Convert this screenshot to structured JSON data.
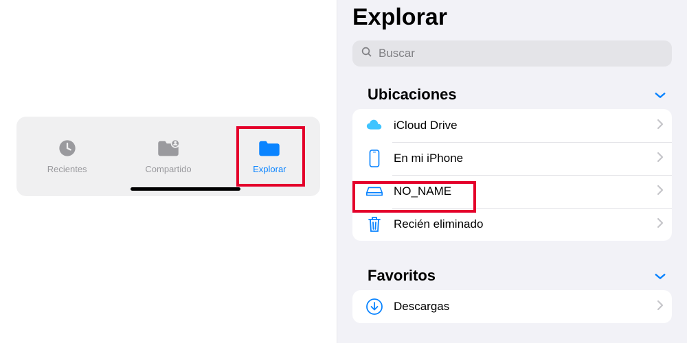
{
  "tabs": {
    "recent": "Recientes",
    "shared": "Compartido",
    "browse": "Explorar"
  },
  "browse": {
    "title": "Explorar",
    "search_placeholder": "Buscar",
    "sections": {
      "locations": {
        "title": "Ubicaciones",
        "items": {
          "icloud": "iCloud Drive",
          "iphone": "En mi iPhone",
          "noname": "NO_NAME",
          "trash": "Recién eliminado"
        }
      },
      "favorites": {
        "title": "Favoritos",
        "items": {
          "downloads": "Descargas"
        }
      }
    }
  }
}
